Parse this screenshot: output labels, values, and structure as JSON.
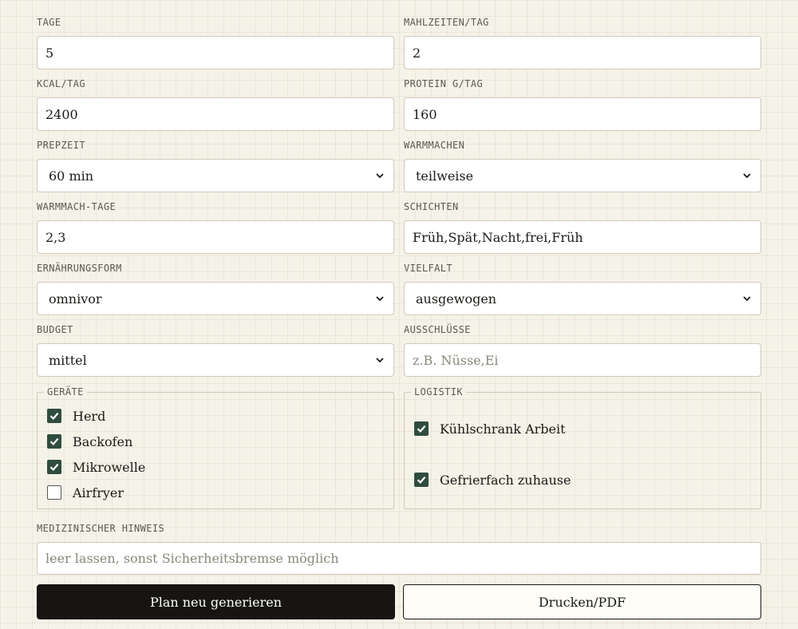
{
  "colors": {
    "accent": "#2f4d3e",
    "primary_button_bg": "#161512",
    "page_bg": "#f5f2e8"
  },
  "fields": {
    "tage": {
      "label": "TAGE",
      "value": "5"
    },
    "mahlzeiten": {
      "label": "MAHLZEITEN/TAG",
      "value": "2"
    },
    "kcal": {
      "label": "KCAL/TAG",
      "value": "2400"
    },
    "protein": {
      "label": "PROTEIN G/TAG",
      "value": "160"
    },
    "prepzeit": {
      "label": "PREPZEIT",
      "value": "60 min"
    },
    "warmmachen": {
      "label": "WARMMACHEN",
      "value": "teilweise"
    },
    "warmmach_tage": {
      "label": "WARMMACH-TAGE",
      "value": "2,3"
    },
    "schichten": {
      "label": "SCHICHTEN",
      "value": "Früh,Spät,Nacht,frei,Früh"
    },
    "ernaehrungsform": {
      "label": "ERNÄHRUNGSFORM",
      "value": "omnivor"
    },
    "vielfalt": {
      "label": "VIELFALT",
      "value": "ausgewogen"
    },
    "budget": {
      "label": "BUDGET",
      "value": "mittel"
    },
    "ausschluesse": {
      "label": "AUSSCHLÜSSE",
      "value": "",
      "placeholder": "z.B. Nüsse,Ei"
    },
    "medizinisch": {
      "label": "MEDIZINISCHER HINWEIS",
      "value": "",
      "placeholder": "leer lassen, sonst Sicherheitsbremse möglich"
    }
  },
  "geraete": {
    "legend": "GERÄTE",
    "items": [
      {
        "label": "Herd",
        "checked": true
      },
      {
        "label": "Backofen",
        "checked": true
      },
      {
        "label": "Mikrowelle",
        "checked": true
      },
      {
        "label": "Airfryer",
        "checked": false
      }
    ]
  },
  "logistik": {
    "legend": "LOGISTIK",
    "items": [
      {
        "label": "Kühlschrank Arbeit",
        "checked": true
      },
      {
        "label": "Gefrierfach zuhause",
        "checked": true
      }
    ]
  },
  "buttons": {
    "generate": "Plan neu generieren",
    "print": "Drucken/PDF"
  }
}
